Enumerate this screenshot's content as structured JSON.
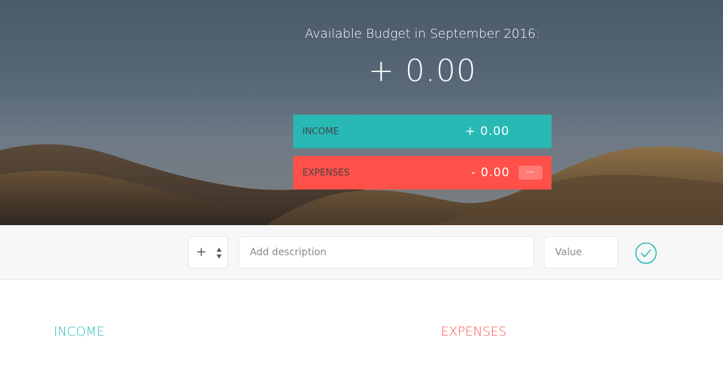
{
  "budget": {
    "title": "Available Budget in September 2016:",
    "value": "+ 0.00",
    "income": {
      "label": "INCOME",
      "value": "+ 0.00"
    },
    "expenses": {
      "label": "EXPENSES",
      "value": "- 0.00",
      "percentage": "---"
    }
  },
  "add": {
    "type_value": "+",
    "description_placeholder": "Add description",
    "value_placeholder": "Value"
  },
  "lists": {
    "income_title": "INCOME",
    "expenses_title": "EXPENSES"
  },
  "colors": {
    "income": "#28b9b5",
    "expenses": "#ff5049"
  },
  "icons": {
    "add_button": "checkmark-circle-icon",
    "type_select": "up-down-arrows-icon"
  }
}
